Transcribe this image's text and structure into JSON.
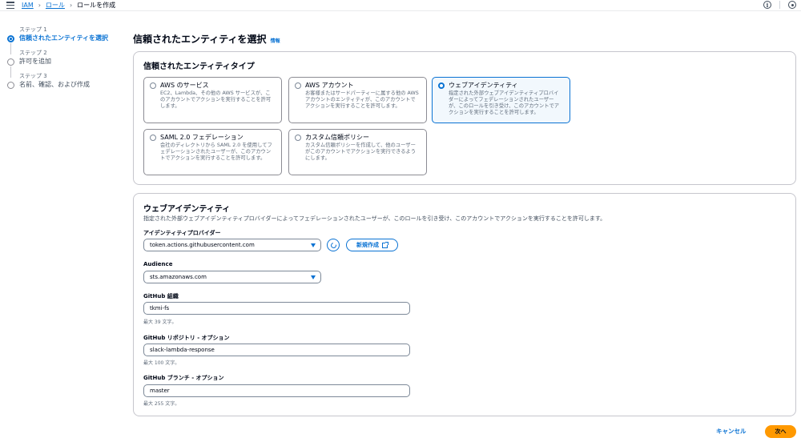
{
  "breadcrumbs": {
    "iam": "IAM",
    "roles": "ロール",
    "current": "ロールを作成"
  },
  "steps": [
    {
      "label": "ステップ 1",
      "title": "信頼されたエンティティを選択",
      "active": true
    },
    {
      "label": "ステップ 2",
      "title": "許可を追加",
      "active": false
    },
    {
      "label": "ステップ 3",
      "title": "名前、確認、および作成",
      "active": false
    }
  ],
  "page": {
    "title": "信頼されたエンティティを選択",
    "info": "情報"
  },
  "entity_type": {
    "title": "信頼されたエンティティタイプ",
    "options": [
      {
        "title": "AWS のサービス",
        "desc": "EC2、Lambda、その他の AWS サービスが、このアカウントでアクションを実行することを許可します。",
        "selected": false
      },
      {
        "title": "AWS アカウント",
        "desc": "お客様またはサードパーティーに属する他の AWS アカウントのエンティティが、このアカウントでアクションを実行することを許可します。",
        "selected": false
      },
      {
        "title": "ウェブアイデンティティ",
        "desc": "指定された外部ウェブアイデンティティプロバイダーによってフェデレーションされたユーザーが、このロールを引き受け、このアカウントでアクションを実行することを許可します。",
        "selected": true
      },
      {
        "title": "SAML 2.0 フェデレーション",
        "desc": "会社のディレクトリから SAML 2.0 を使用してフェデレーションされたユーザーが、このアカウントでアクションを実行することを許可します。",
        "selected": false
      },
      {
        "title": "カスタム信頼ポリシー",
        "desc": "カスタム信頼ポリシーを作成して、他のユーザーがこのアカウントでアクションを実行できるようにします。",
        "selected": false
      }
    ]
  },
  "web_identity": {
    "title": "ウェブアイデンティティ",
    "desc": "指定された外部ウェブアイデンティティプロバイダーによってフェデレーションされたユーザーが、このロールを引き受け、このアカウントでアクションを実行することを許可します。",
    "provider_label": "アイデンティティプロバイダー",
    "provider_value": "token.actions.githubusercontent.com",
    "new_label": "新規作成",
    "audience_label": "Audience",
    "audience_value": "sts.amazonaws.com",
    "org_label": "GitHub 組織",
    "org_value": "tkmi-fs",
    "org_hint": "最大 39 文字。",
    "repo_label": "GitHub リポジトリ - オプション",
    "repo_value": "slack-lambda-response",
    "repo_hint": "最大 100 文字。",
    "branch_label": "GitHub ブランチ - オプション",
    "branch_value": "master",
    "branch_hint": "最大 255 文字。"
  },
  "footer": {
    "cancel": "キャンセル",
    "next": "次へ"
  },
  "colors": {
    "accent": "#0972d3",
    "primary_button": "#ff9900",
    "border": "#c6c6cd"
  }
}
